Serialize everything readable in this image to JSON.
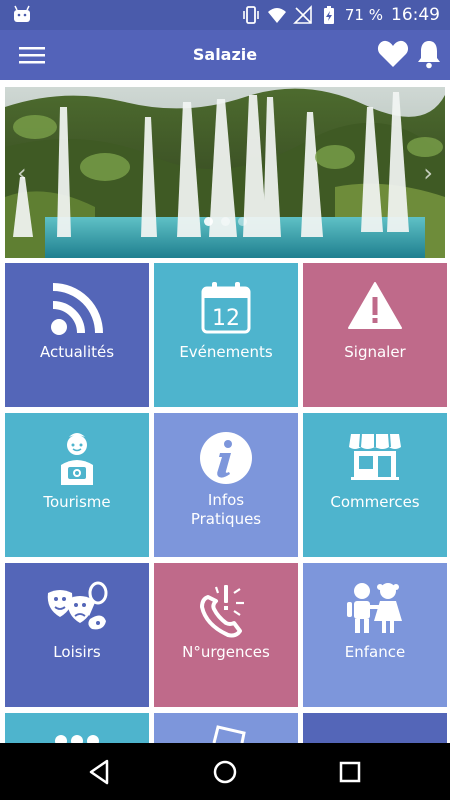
{
  "status_bar": {
    "battery_percent": "71 %",
    "time": "16:49"
  },
  "app_bar": {
    "title": "Salazie"
  },
  "banner": {
    "prev_glyph": "‹",
    "next_glyph": "›",
    "slide_count": 3,
    "active_slide": 1
  },
  "tiles": [
    {
      "label": "Actualités",
      "icon": "rss-icon",
      "color": "#5466b8"
    },
    {
      "label": "Evénements",
      "icon": "calendar-icon",
      "calendar_day": "12",
      "color": "#4eb4cd"
    },
    {
      "label": "Signaler",
      "icon": "warning-icon",
      "color": "#bf6a8a"
    },
    {
      "label": "Tourisme",
      "icon": "tourist-icon",
      "color": "#4eb4cd"
    },
    {
      "label_line1": "Infos",
      "label_line2": "Pratiques",
      "icon": "info-icon",
      "color": "#7d96db"
    },
    {
      "label": "Commerces",
      "icon": "shop-icon",
      "color": "#4eb4cd"
    },
    {
      "label": "Loisirs",
      "icon": "leisure-icon",
      "color": "#5466b8"
    },
    {
      "label": "N°urgences",
      "icon": "emergency-phone-icon",
      "color": "#bf6a8a"
    },
    {
      "label": "Enfance",
      "icon": "children-icon",
      "color": "#7d96db"
    }
  ],
  "colors": {
    "status_bar": "#4a5bab",
    "app_bar": "#5363b9",
    "blue": "#5466b8",
    "teal": "#4eb4cd",
    "pink": "#bf6a8a",
    "lavender": "#7d96db"
  }
}
